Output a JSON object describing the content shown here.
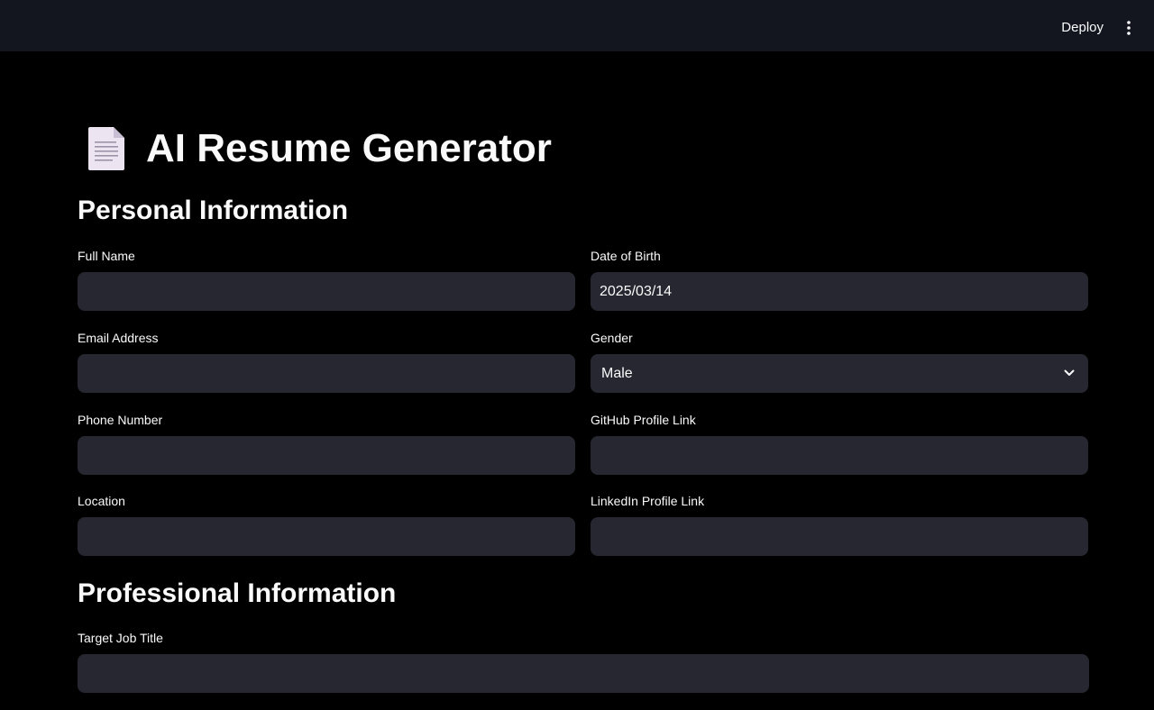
{
  "header": {
    "deploy_label": "Deploy"
  },
  "page": {
    "title": "AI Resume Generator",
    "title_icon": "page-document-icon"
  },
  "personal": {
    "heading": "Personal Information",
    "full_name": {
      "label": "Full Name",
      "value": ""
    },
    "dob": {
      "label": "Date of Birth",
      "value": "2025/03/14"
    },
    "email": {
      "label": "Email Address",
      "value": ""
    },
    "gender": {
      "label": "Gender",
      "value": "Male"
    },
    "phone": {
      "label": "Phone Number",
      "value": ""
    },
    "github": {
      "label": "GitHub Profile Link",
      "value": ""
    },
    "location": {
      "label": "Location",
      "value": ""
    },
    "linkedin": {
      "label": "LinkedIn Profile Link",
      "value": ""
    }
  },
  "professional": {
    "heading": "Professional Information",
    "job_title": {
      "label": "Target Job Title",
      "value": ""
    }
  },
  "colors": {
    "background": "#000000",
    "topbar": "#13161f",
    "input_bg": "#262730",
    "text": "#fafafa"
  }
}
